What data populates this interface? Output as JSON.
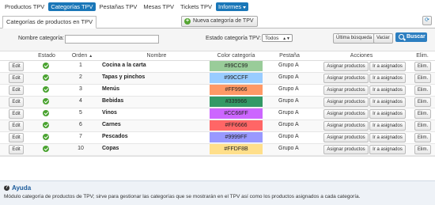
{
  "nav": {
    "items": [
      {
        "label": "Productos TPV",
        "active": false
      },
      {
        "label": "Categorías TPV",
        "active": true
      },
      {
        "label": "Pestañas TPV",
        "active": false
      },
      {
        "label": "Mesas TPV",
        "active": false
      },
      {
        "label": "Tickets TPV",
        "active": false
      },
      {
        "label": "Informes",
        "active": true
      }
    ]
  },
  "tab": {
    "title": "Categorías de productos en TPV"
  },
  "toolbar": {
    "new_category_label": "Nueva categoría de TPV"
  },
  "filters": {
    "name_label": "Nombre categoría:",
    "name_value": "",
    "status_label": "Estado categoría TPV:",
    "status_value": "Todos",
    "last_search_label": "Última búsqueda",
    "clear_label": "Vaciar",
    "search_label": "Buscar"
  },
  "table": {
    "headers": {
      "estado": "Estado",
      "orden": "Orden",
      "nombre": "Nombre",
      "color": "Color categoría",
      "pestana": "Pestaña",
      "acciones": "Acciones",
      "elim": "Elim."
    },
    "edit_label": "Edit",
    "assign_label": "Asignar productos",
    "goto_label": "Ir a asignados",
    "delete_label": "Elim.",
    "rows": [
      {
        "order": "1",
        "name": "Cocina a la carta",
        "color": "#99CC99",
        "group": "Grupo A"
      },
      {
        "order": "2",
        "name": "Tapas y pinchos",
        "color": "#99CCFF",
        "group": "Grupo A"
      },
      {
        "order": "3",
        "name": "Menús",
        "color": "#FF9966",
        "group": "Grupo A"
      },
      {
        "order": "4",
        "name": "Bebidas",
        "color": "#339966",
        "group": "Grupo A"
      },
      {
        "order": "5",
        "name": "Vinos",
        "color": "#CC66FF",
        "group": "Grupo A"
      },
      {
        "order": "6",
        "name": "Carnes",
        "color": "#FF6666",
        "group": "Grupo A"
      },
      {
        "order": "7",
        "name": "Pescados",
        "color": "#9999FF",
        "group": "Grupo A"
      },
      {
        "order": "10",
        "name": "Copas",
        "color": "#FFDF8B",
        "group": "Grupo A"
      }
    ]
  },
  "help": {
    "title": "Ayuda",
    "text": "Módulo categoría de productos de TPV; sirve para gestionar las categorías que se mostrarán en el TPV así como los productos asignados a cada categoría."
  },
  "colors": {
    "accent": "#1a77b8",
    "status_active": "#4aa330"
  }
}
